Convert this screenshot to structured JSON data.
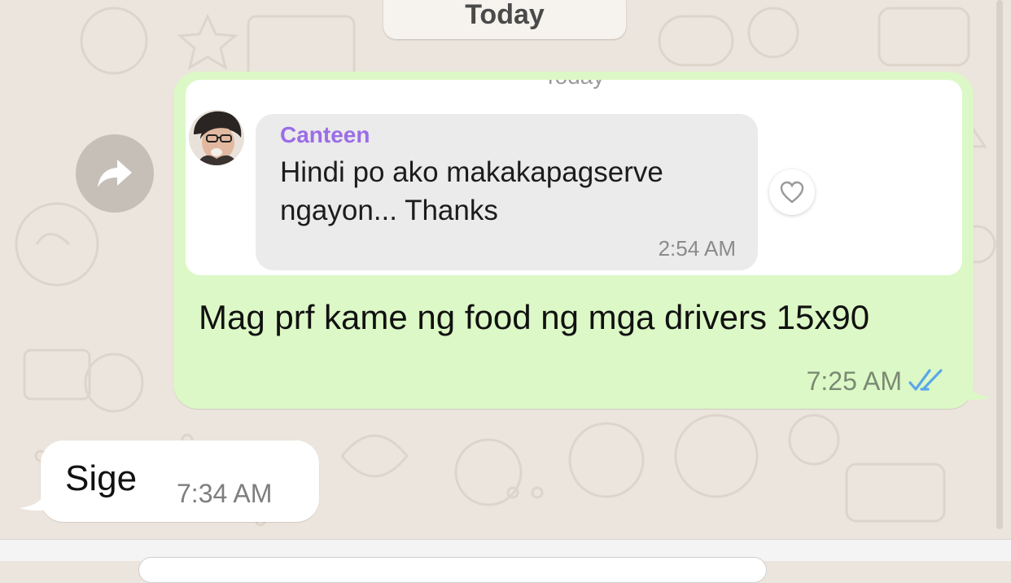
{
  "date_divider": {
    "label": "Today"
  },
  "outgoing_message": {
    "story_reply": {
      "ghost_label": "Today",
      "sender": "Canteen",
      "text": "Hindi po ako makakapagserve ngayon... Thanks",
      "time": "2:54 AM"
    },
    "text": "Mag prf kame ng food ng mga drivers 15x90",
    "time": "7:25 AM",
    "status": "read",
    "tick_color": "#5aa7e8"
  },
  "incoming_message": {
    "text": "Sige",
    "time": "7:34 AM"
  },
  "icons": {
    "forward": "forward-arrow-icon",
    "like": "heart-icon",
    "read_receipt": "double-check-icon"
  },
  "colors": {
    "chat_background": "#ece5dd",
    "outgoing_bubble": "#dcf8c6",
    "incoming_bubble": "#ffffff",
    "sender_name": "#9b6de6"
  }
}
